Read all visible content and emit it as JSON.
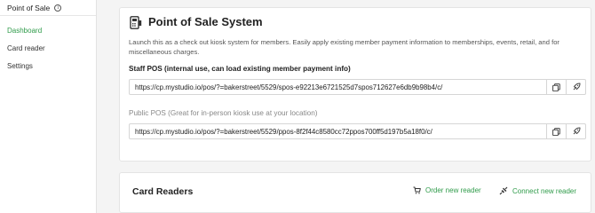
{
  "sidebar": {
    "header": "Point of Sale",
    "header_icon": "info-icon",
    "items": [
      {
        "label": "Dashboard",
        "active": true
      },
      {
        "label": "Card reader",
        "active": false
      },
      {
        "label": "Settings",
        "active": false
      }
    ]
  },
  "pos": {
    "title": "Point of Sale System",
    "title_icon": "pos-terminal-icon",
    "description": "Launch this as a check out kiosk system for members. Easily apply existing member payment information to memberships, events, retail, and for miscellaneous charges.",
    "staff_label": "Staff POS (internal use, can load existing member payment info)",
    "staff_url": "https://cp.mystudio.io/pos/?=bakerstreet/5529/spos-e92213e6721525d7spos712627e6db9b98b4/c/",
    "public_label": "Public POS (Great for in-person kiosk use at your location)",
    "public_url": "https://cp.mystudio.io/pos/?=bakerstreet/5529/ppos-8f2f44c8580cc72ppos700ff5d197b5a18f0/c/",
    "copy_icon": "copy-icon",
    "open_icon": "launch-icon"
  },
  "card_readers": {
    "title": "Card Readers",
    "order_label": "Order new reader",
    "connect_label": "Connect new reader"
  },
  "colors": {
    "accent": "#2f9b4a",
    "muted_label": "#888888"
  }
}
